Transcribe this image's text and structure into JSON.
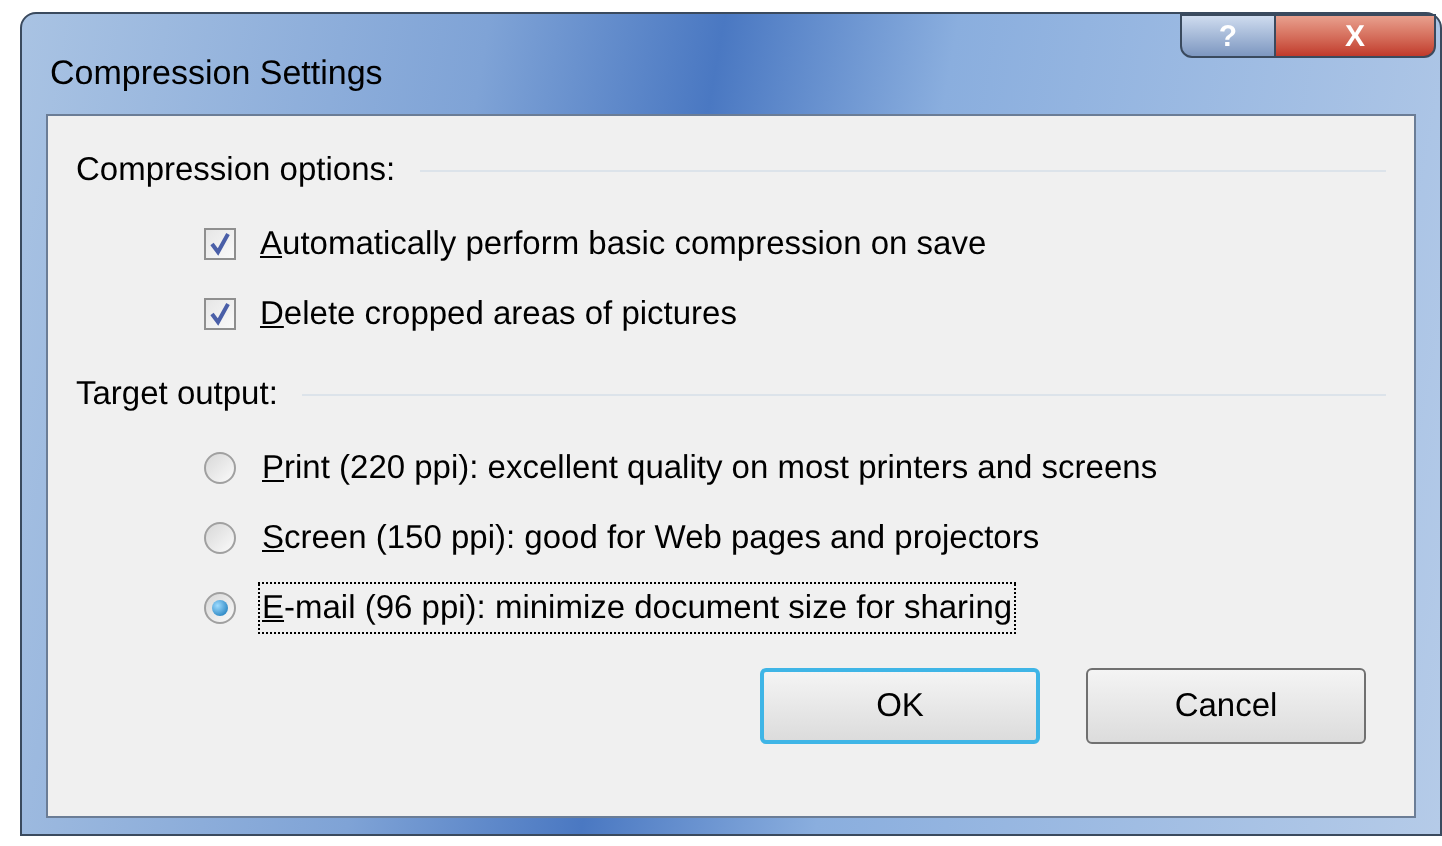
{
  "window": {
    "title": "Compression Settings",
    "help_button": "?",
    "close_button": "X"
  },
  "compression_options": {
    "heading": "Compression options:",
    "items": [
      {
        "label": "Automatically perform basic compression on save",
        "checked": true
      },
      {
        "label": "Delete cropped areas of pictures",
        "checked": true
      }
    ]
  },
  "target_output": {
    "heading": "Target output:",
    "items": [
      {
        "label": "Print (220 ppi): excellent quality on most printers and screens",
        "selected": false
      },
      {
        "label": "Screen (150 ppi): good for Web pages and projectors",
        "selected": false
      },
      {
        "label": "E-mail (96 ppi): minimize document size for sharing",
        "selected": true
      }
    ]
  },
  "buttons": [
    {
      "label": "OK",
      "default": true
    },
    {
      "label": "Cancel",
      "default": false
    }
  ]
}
